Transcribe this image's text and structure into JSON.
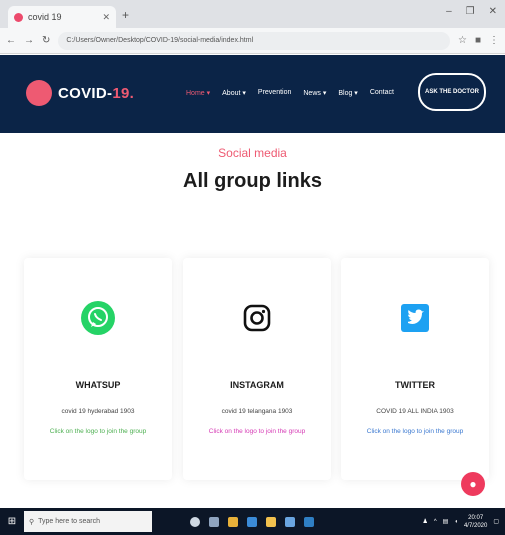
{
  "browser": {
    "tab_title": "covid 19",
    "url": "C:/Users/Owner/Desktop/COVID-19/social-media/index.html",
    "window_controls": [
      "–",
      "❐",
      "✕"
    ]
  },
  "site": {
    "logo_main": "COVID-",
    "logo_accent": "19.",
    "nav": [
      {
        "label": "Home ▾",
        "active": true
      },
      {
        "label": "About ▾",
        "active": false
      },
      {
        "label": "Prevention",
        "active": false
      },
      {
        "label": "News ▾",
        "active": false
      },
      {
        "label": "Blog ▾",
        "active": false
      },
      {
        "label": "Contact",
        "active": false
      }
    ],
    "cta": "ASK THE DOCTOR"
  },
  "section": {
    "subtitle": "Social media",
    "heading": "All group links"
  },
  "cards": [
    {
      "icon": "whatsapp-icon",
      "title": "WHATSUP",
      "desc": "covid 19 hyderabad 1903",
      "link": "Click on the logo to join the group",
      "link_color": "#4caf50"
    },
    {
      "icon": "instagram-icon",
      "title": "INSTAGRAM",
      "desc": "covid 19 telangana 1903",
      "link": "Click on the logo to join the group",
      "link_color": "#d63bb5"
    },
    {
      "icon": "twitter-icon",
      "title": "TWITTER",
      "desc": "COVID 19 ALL INDIA 1903",
      "link": "Click on the logo to join the group",
      "link_color": "#3a78d0"
    }
  ],
  "taskbar": {
    "search_placeholder": "Type here to search",
    "time": "20:07",
    "date": "4/7/2020"
  },
  "colors": {
    "header_bg": "#0b2447",
    "accent": "#ee5a72",
    "whatsapp": "#25d366",
    "twitter": "#1da1f2"
  }
}
